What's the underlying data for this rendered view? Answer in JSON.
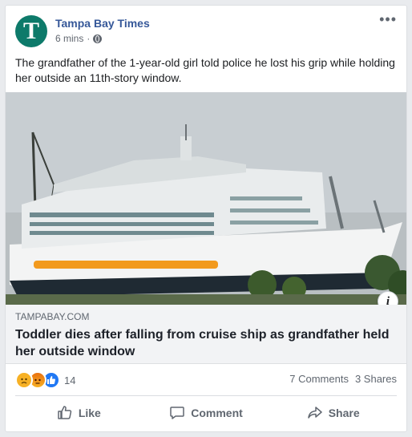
{
  "post": {
    "page_name": "Tampa Bay Times",
    "avatar_letter": "T",
    "timestamp": "6 mins",
    "separator": "·",
    "more_icon": "•••",
    "text": "The grandfather of the 1-year-old girl told police he lost his grip while holding her outside an 11th-story window."
  },
  "link": {
    "domain": "TAMPABAY.COM",
    "headline": "Toddler dies after falling from cruise ship as grandfather held her outside window",
    "info_symbol": "i"
  },
  "stats": {
    "reaction_count": "14",
    "comments": "7 Comments",
    "shares": "3 Shares"
  },
  "actions": {
    "like": "Like",
    "comment": "Comment",
    "share": "Share"
  },
  "colors": {
    "page_name": "#365899",
    "avatar": "#0d7a6a",
    "link_bg": "#f2f3f5"
  }
}
